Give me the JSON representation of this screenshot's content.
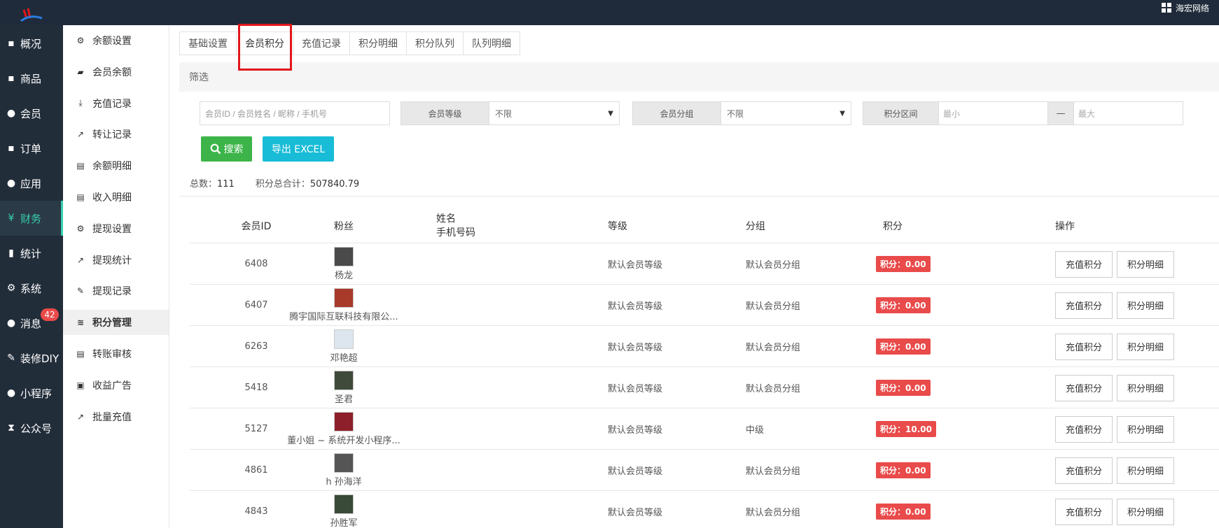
{
  "topbar": {
    "brand": "海宏网络"
  },
  "leftnav": {
    "items": [
      {
        "label": "概况",
        "icon": "▪"
      },
      {
        "label": "商品",
        "icon": "▪"
      },
      {
        "label": "会员",
        "icon": "●"
      },
      {
        "label": "订单",
        "icon": "▪"
      },
      {
        "label": "应用",
        "icon": "●"
      },
      {
        "label": "财务",
        "icon": "¥"
      },
      {
        "label": "统计",
        "icon": "▮"
      },
      {
        "label": "系统",
        "icon": "⚙"
      },
      {
        "label": "消息",
        "icon": "●"
      },
      {
        "label": "装修DIY",
        "icon": "✎"
      },
      {
        "label": "小程序",
        "icon": "●"
      },
      {
        "label": "公众号",
        "icon": "⧗"
      }
    ],
    "message_badge": "42"
  },
  "subnav": {
    "items": [
      {
        "label": "余额设置",
        "icon": "⚙"
      },
      {
        "label": "会员余额",
        "icon": "▰"
      },
      {
        "label": "充值记录",
        "icon": "⤓"
      },
      {
        "label": "转让记录",
        "icon": "↗"
      },
      {
        "label": "余额明细",
        "icon": "▤"
      },
      {
        "label": "收入明细",
        "icon": "▤"
      },
      {
        "label": "提现设置",
        "icon": "⚙"
      },
      {
        "label": "提现统计",
        "icon": "↗"
      },
      {
        "label": "提现记录",
        "icon": "✎"
      },
      {
        "label": "积分管理",
        "icon": "≋"
      },
      {
        "label": "转账审核",
        "icon": "▤"
      },
      {
        "label": "收益广告",
        "icon": "▣"
      },
      {
        "label": "批量充值",
        "icon": "↗"
      }
    ]
  },
  "tabs": [
    "基础设置",
    "会员积分",
    "充值记录",
    "积分明细",
    "积分队列",
    "队列明细"
  ],
  "filter": {
    "title": "筛选",
    "search_placeholder": "会员ID / 会员姓名 / 昵称 / 手机号",
    "level_label": "会员等级",
    "level_value": "不限",
    "group_label": "会员分组",
    "group_value": "不限",
    "range_label": "积分区间",
    "range_min": "最小",
    "range_sep": "—",
    "range_max": "最大",
    "search_btn": "搜索",
    "export_btn": "导出 EXCEL"
  },
  "summary": {
    "total_label": "总数：",
    "total_value": "111",
    "sum_label": "积分总合计：",
    "sum_value": "507840.79"
  },
  "table": {
    "headers": {
      "id": "会员ID",
      "fans": "粉丝",
      "name": "姓名",
      "phone": "手机号码",
      "level": "等级",
      "group": "分组",
      "score": "积分",
      "ops": "操作"
    },
    "rows": [
      {
        "id": "6408",
        "fan": "杨龙",
        "level": "默认会员等级",
        "group": "默认会员分组",
        "score": "积分：0.00",
        "avatar": "#4a4a4a"
      },
      {
        "id": "6407",
        "fan": "腾宇国际互联科技有限公...",
        "level": "默认会员等级",
        "group": "默认会员分组",
        "score": "积分：0.00",
        "avatar": "#a83a2a"
      },
      {
        "id": "6263",
        "fan": "邓艳超",
        "level": "默认会员等级",
        "group": "默认会员分组",
        "score": "积分：0.00",
        "avatar": "#dde6ee"
      },
      {
        "id": "5418",
        "fan": "圣君",
        "level": "默认会员等级",
        "group": "默认会员分组",
        "score": "积分：0.00",
        "avatar": "#3f4a3a"
      },
      {
        "id": "5127",
        "fan": "董小姐 ~ 系统开发小程序...",
        "level": "默认会员等级",
        "group": "中级",
        "score": "积分：10.00",
        "avatar": "#8c1f2a"
      },
      {
        "id": "4861",
        "fan": "h 孙海洋",
        "level": "默认会员等级",
        "group": "默认会员分组",
        "score": "积分：0.00",
        "avatar": "#555555"
      },
      {
        "id": "4843",
        "fan": "孙胜军",
        "level": "默认会员等级",
        "group": "默认会员分组",
        "score": "积分：0.00",
        "avatar": "#3a4a38"
      }
    ],
    "op_recharge": "充值积分",
    "op_detail": "积分明细"
  },
  "colors": {
    "active_nav": "#37d0b0",
    "score_badge": "#e94a4a",
    "search_btn": "#3cb449",
    "export_btn": "#18bcd6"
  }
}
